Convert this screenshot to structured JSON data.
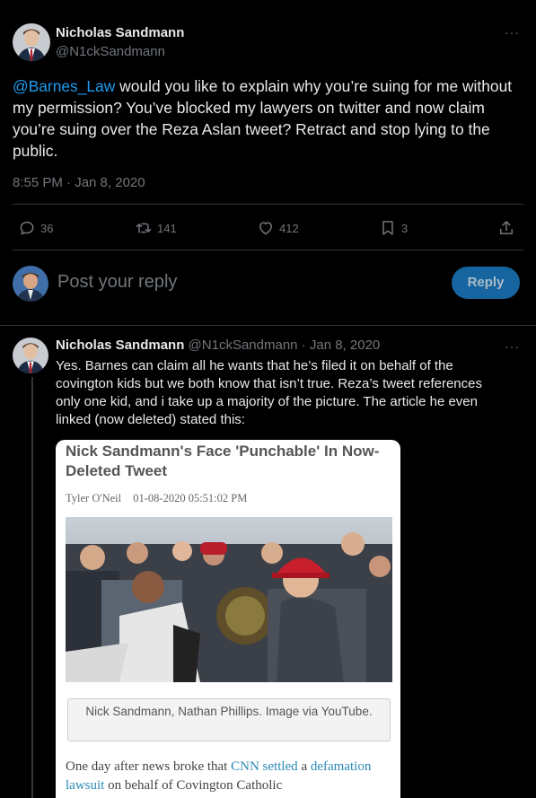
{
  "main_tweet": {
    "author_name": "Nicholas Sandmann",
    "author_handle": "@N1ckSandmann",
    "more_label": "···",
    "mention": "@Barnes_Law",
    "text": " would you like to explain why you’re suing for me without my permission? You’ve blocked my lawyers on twitter and now claim you’re suing over the Reza Aslan tweet? Retract and stop lying to the public.",
    "timestamp": "8:55 PM · Jan 8, 2020",
    "actions": {
      "replies": "36",
      "retweets": "141",
      "likes": "412",
      "bookmarks": "3"
    }
  },
  "composer": {
    "placeholder": "Post your reply",
    "button_label": "Reply"
  },
  "reply_tweet": {
    "author_name": "Nicholas Sandmann",
    "author_handle": "@N1ckSandmann",
    "date": "· Jan 8, 2020",
    "more_label": "···",
    "text": "Yes. Barnes can claim all he wants that he’s filed it on behalf of the covington kids but we both know that isn’t true. Reza’s tweet references only one kid, and i take up a majority of the picture. The article he even linked (now deleted) stated this:"
  },
  "article_card": {
    "title": "Nick Sandmann's Face 'Punchable' In Now-Deleted Tweet",
    "author": "Tyler O'Neil",
    "datetime": "01-08-2020 05:51:02 PM",
    "caption": "Nick Sandmann, Nathan Phillips. Image via YouTube.",
    "body_part1": "One day after news broke that ",
    "body_link1": "CNN settled",
    "body_part2": " a ",
    "body_link2": "defamation lawsuit",
    "body_part3": " on behalf of Covington Catholic"
  },
  "colors": {
    "background": "#000000",
    "text": "#e7e9ea",
    "muted": "#71767b",
    "accent": "#1d9bf0",
    "divider": "#2f3336"
  }
}
